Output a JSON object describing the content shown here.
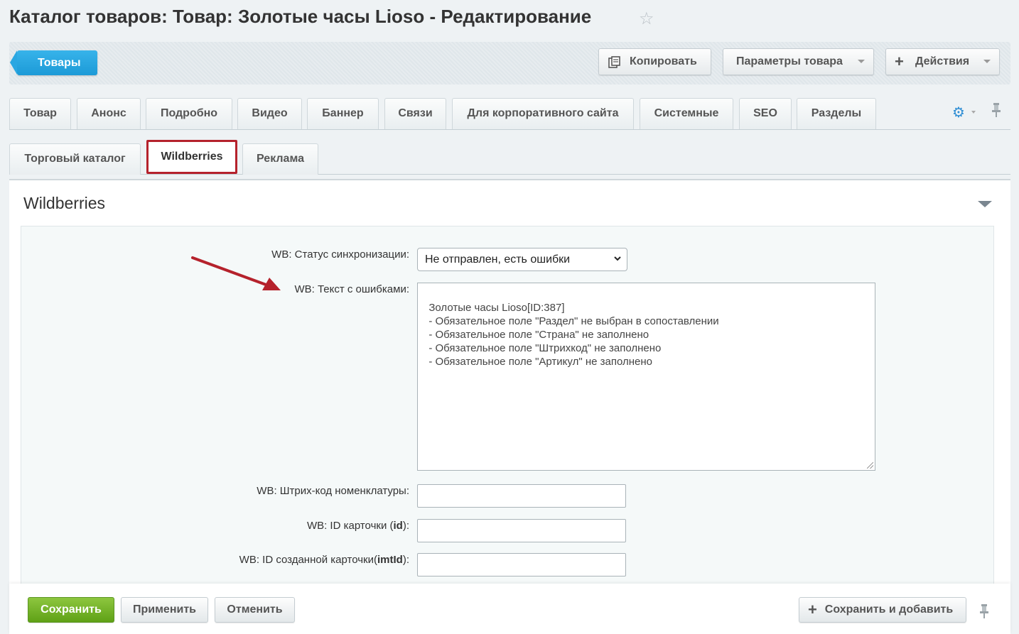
{
  "header": {
    "title": "Каталог товаров: Товар: Золотые часы Lioso - Редактирование"
  },
  "toolbar": {
    "back_label": "Товары",
    "copy_label": "Копировать",
    "params_label": "Параметры товара",
    "actions_label": "Действия"
  },
  "tabs_row1": [
    "Товар",
    "Анонс",
    "Подробно",
    "Видео",
    "Баннер",
    "Связи",
    "Для корпоративного сайта",
    "Системные",
    "SEO",
    "Разделы"
  ],
  "tabs_row2": [
    "Торговый каталог",
    "Wildberries",
    "Реклама"
  ],
  "active_tab": "Wildberries",
  "section": {
    "title": "Wildberries"
  },
  "form": {
    "sync_status_label": "WB: Статус синхронизации:",
    "sync_status_value": "Не отправлен, есть ошибки",
    "errors_label": "WB: Текст с ошибками:",
    "errors_text": "Золотые часы Lioso[ID:387]\n  - Обязательное поле \"Раздел\" не выбран в сопоставлении\n  - Обязательное поле \"Страна\" не заполнено\n  - Обязательное поле \"Штрихкод\" не заполнено\n  - Обязательное поле \"Артикул\" не заполнено",
    "barcode_label": "WB: Штрих-код номенклатуры:",
    "barcode_value": "",
    "card_id_label_prefix": "WB: ID карточки (",
    "card_id_label_bold": "id",
    "card_id_label_suffix": "):",
    "card_id_value": "",
    "created_id_label_prefix": "WB: ID созданной карточки(",
    "created_id_label_bold": "imtId",
    "created_id_label_suffix": "):",
    "created_id_value": ""
  },
  "footer": {
    "save_label": "Сохранить",
    "apply_label": "Применить",
    "cancel_label": "Отменить",
    "save_add_label": "Сохранить и добавить"
  },
  "colors": {
    "accent_blue": "#1c9ad7",
    "save_green": "#5fa116",
    "highlight_red": "#b5222c"
  }
}
